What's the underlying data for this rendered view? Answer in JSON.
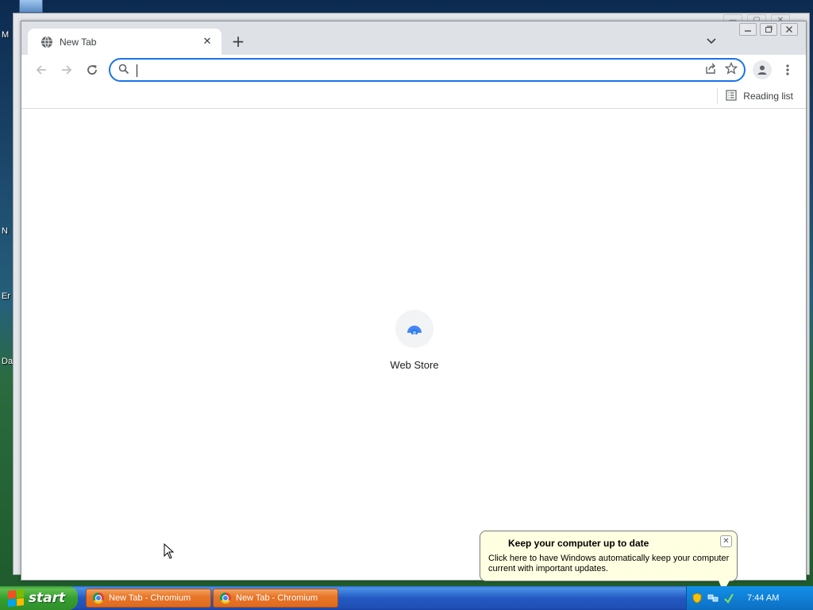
{
  "desktop": {
    "icon_labels": [
      "M",
      "N",
      "Er",
      "Da"
    ]
  },
  "browser": {
    "tab": {
      "title": "New Tab",
      "close_glyph": "✕"
    },
    "new_tab_glyph": "+",
    "omnibox": {
      "value": "",
      "placeholder": ""
    },
    "bookmarks_bar": {
      "reading_list_label": "Reading list"
    },
    "shortcuts": [
      {
        "label": "Web Store"
      }
    ]
  },
  "notification": {
    "title": "Keep your computer up to date",
    "body": "Click here to have Windows automatically keep your computer current with important updates.",
    "close_glyph": "✕"
  },
  "taskbar": {
    "start_label": "start",
    "buttons": [
      {
        "label": "New Tab - Chromium"
      },
      {
        "label": "New Tab - Chromium"
      }
    ],
    "clock": "7:44 AM"
  },
  "colors": {
    "accent": "#1a73e8",
    "taskbar_blue": "#2459c4",
    "start_green": "#35a030",
    "task_button_orange": "#e8772a",
    "balloon_bg": "#ffffe1"
  }
}
